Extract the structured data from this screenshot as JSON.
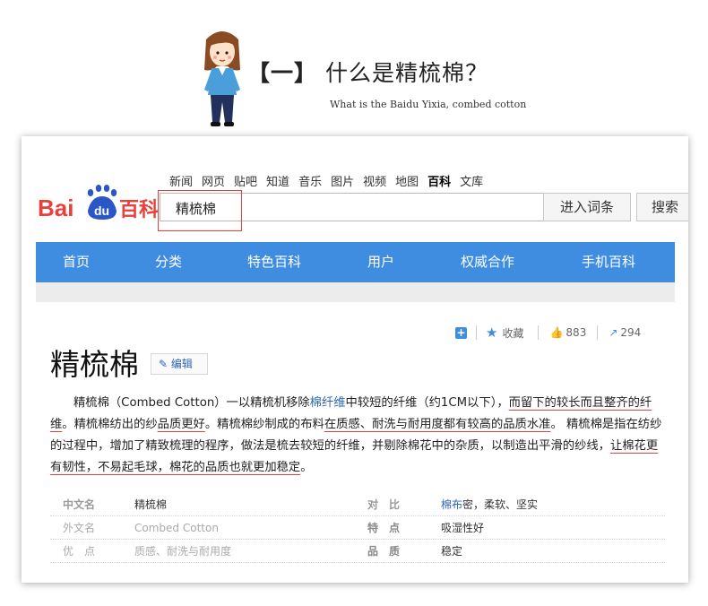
{
  "intro": {
    "heading_bracket": "【一】",
    "heading_text": "什么是精梳棉？",
    "subtitle": "What is the Baidu Yixia, combed cotton"
  },
  "baike": {
    "logo_text": {
      "bai": "Bai",
      "du": "du",
      "baike": "百科"
    },
    "top_nav": [
      "新闻",
      "网页",
      "贴吧",
      "知道",
      "音乐",
      "图片",
      "视频",
      "地图",
      "百科",
      "文库"
    ],
    "top_nav_active": "百科",
    "search_value": "精梳棉",
    "enter_button": "进入词条",
    "search_button": "搜索",
    "main_nav": [
      "首页",
      "分类",
      "特色百科",
      "用户",
      "权威合作",
      "手机百科"
    ],
    "actions": {
      "collect": "收藏",
      "likes": "883",
      "shares": "294"
    },
    "entry_title": "精梳棉",
    "edit_label": "编辑",
    "summary": {
      "s1": "精梳棉（Combed Cotton）一以精梳机移除",
      "s1_link": "棉纤维",
      "s1b": "中较短的纤维（约1CM以下），",
      "s2_u": "而留下的较长而且整齐的纤维",
      "s3": "。精梳棉纺出的纱",
      "s3_u": "品质更好",
      "s4": "。精梳棉纱制成的布料",
      "s4_u": "在质感、耐洗与耐用度都有较高的品质水准",
      "s5": "。 精梳棉是指在纺纱的过程中，增加了精致梳理的程序，做法是梳去较短的纤维，并剔除棉花中的杂质，以制造出平滑的纱线，",
      "s6_u": "让棉花更有韧性，不易起毛球，棉花的品质也就更加稳定",
      "s7": "。"
    },
    "info_rows": [
      {
        "k1": "中文名",
        "v1": "精梳棉",
        "k2": "对　比",
        "v2_link": "棉布",
        "v2": "密，柔软、坚实"
      },
      {
        "k1": "外文名",
        "v1": "Combed Cotton",
        "k2": "特　点",
        "v2_link": "",
        "v2": "吸湿性好"
      },
      {
        "k1": "优　点",
        "v1": "质感、耐洗与耐用度",
        "k2": "品　质",
        "v2_link": "",
        "v2": "稳定"
      }
    ]
  },
  "colors": {
    "nav_blue": "#3f8de0",
    "logo_red": "#e8413c",
    "logo_blue": "#2a56c6",
    "underline_red": "#e8413c",
    "link_blue": "#2c64b8"
  }
}
